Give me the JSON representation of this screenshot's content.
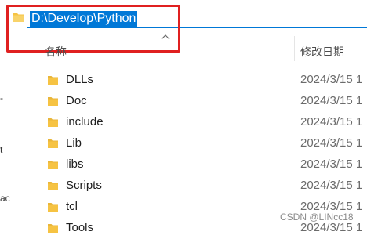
{
  "address_bar": {
    "path": "D:\\Develop\\Python",
    "icon": "folder-icon"
  },
  "columns": {
    "name_label": "名称",
    "date_label": "修改日期",
    "sort_indicator": "chevron-up-icon"
  },
  "nav_glyphs": [
    "-",
    "t",
    "ac"
  ],
  "files": [
    {
      "name": "DLLs",
      "modified": "2024/3/15 1",
      "icon": "folder-icon"
    },
    {
      "name": "Doc",
      "modified": "2024/3/15 1",
      "icon": "folder-icon"
    },
    {
      "name": "include",
      "modified": "2024/3/15 1",
      "icon": "folder-icon"
    },
    {
      "name": "Lib",
      "modified": "2024/3/15 1",
      "icon": "folder-icon"
    },
    {
      "name": "libs",
      "modified": "2024/3/15 1",
      "icon": "folder-icon"
    },
    {
      "name": "Scripts",
      "modified": "2024/3/15 1",
      "icon": "folder-icon"
    },
    {
      "name": "tcl",
      "modified": "2024/3/15 1",
      "icon": "folder-icon"
    },
    {
      "name": "Tools",
      "modified": "2024/3/15 1",
      "icon": "folder-icon"
    }
  ],
  "watermark": "CSDN @LINcc18",
  "colors": {
    "selection": "#0078d7",
    "highlight_box": "#e02020",
    "folder": "#f6c343"
  }
}
